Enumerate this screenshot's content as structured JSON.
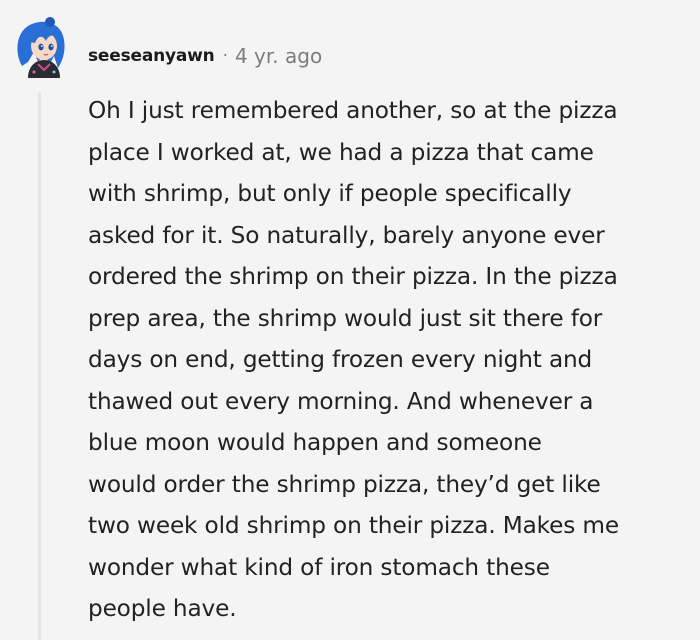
{
  "comment": {
    "username": "seeseanyawn",
    "separator": "·",
    "age": "4 yr. ago",
    "body_lines": [
      "Oh I just remembered another, so at the pizza",
      "place I worked at, we had a pizza that came",
      "with shrimp, but only if people specifically",
      "asked for it. So naturally, barely anyone ever",
      "ordered the shrimp on their pizza. In the pizza",
      "prep area, the shrimp would just sit there for",
      "days on end, getting frozen every night and",
      "thawed out every morning. And whenever a",
      "blue moon would happen and someone",
      "would order the shrimp pizza, they’d get like",
      "two week old shrimp on their pizza. Makes me",
      "wonder what kind of iron stomach these",
      "people have."
    ]
  },
  "avatar": {
    "icon": "anime-character-avatar-icon",
    "hair_color": "#2a6fd6",
    "skin_color": "#f6d9c6"
  },
  "colors": {
    "background": "#f4f4f4",
    "text": "#222222",
    "muted": "#7c7c7c",
    "thread_line": "#e5e5e5"
  }
}
